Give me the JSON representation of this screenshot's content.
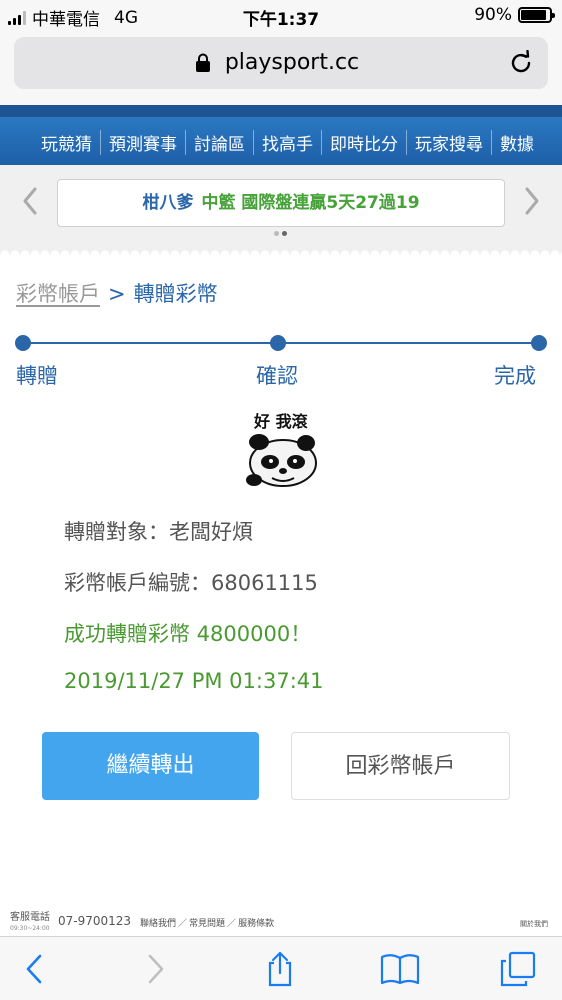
{
  "status_bar": {
    "carrier": "中華電信",
    "network": "4G",
    "time": "下午1:37",
    "battery_percent": "90%",
    "battery_level": 0.9
  },
  "browser": {
    "url": "playsport.cc"
  },
  "nav": {
    "items": [
      "玩競猜",
      "預測賽事",
      "討論區",
      "找高手",
      "即時比分",
      "玩家搜尋",
      "數據"
    ]
  },
  "ticker": {
    "name": "柑八爹",
    "message": "中籃 國際盤連贏5天27過19"
  },
  "breadcrumb": {
    "parent": "彩幣帳戶",
    "separator": ">",
    "current": "轉贈彩幣"
  },
  "steps": [
    "轉贈",
    "確認",
    "完成"
  ],
  "meme": {
    "caption": "好 我滾"
  },
  "result": {
    "recipient": "轉贈對象：老闆好煩",
    "account": "彩幣帳戶編號：68061115",
    "success": "成功轉贈彩幣 4800000！",
    "timestamp": "2019/11/27 PM 01:37:41"
  },
  "buttons": {
    "continue": "繼續轉出",
    "back": "回彩幣帳戶"
  },
  "footer": {
    "service_label": "客服電話",
    "service_hours": "09:30~24:00",
    "phone": "07-9700123",
    "links": [
      "聯絡我們",
      "常見問題",
      "服務條款"
    ],
    "about": "關於我們"
  },
  "colors": {
    "brand_blue": "#2a66a8",
    "success_green": "#4a9a32",
    "button_blue": "#42a5ee"
  }
}
